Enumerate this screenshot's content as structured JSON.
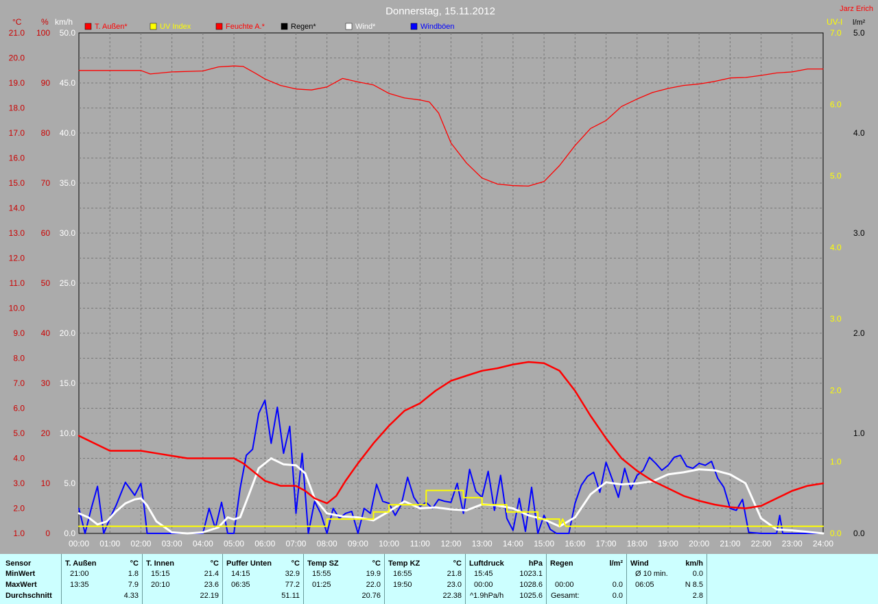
{
  "title": "Donnerstag, 15.11.2012",
  "author": "Jarz Erich",
  "units": {
    "temp": "°C",
    "hum": "%",
    "wind": "km/h",
    "uv": "UV-I",
    "rain": "l/m²"
  },
  "left_axes": {
    "temp_ticks": [
      "21.0",
      "20.0",
      "19.0",
      "18.0",
      "17.0",
      "16.0",
      "15.0",
      "14.0",
      "13.0",
      "12.0",
      "11.0",
      "10.0",
      "9.0",
      "8.0",
      "7.0",
      "6.0",
      "5.0",
      "4.0",
      "3.0",
      "2.0",
      "1.0"
    ],
    "hum_ticks": [
      "100",
      "90",
      "80",
      "70",
      "60",
      "50",
      "40",
      "30",
      "20",
      "10",
      "0"
    ],
    "wind_ticks": [
      "50.0",
      "45.0",
      "40.0",
      "35.0",
      "30.0",
      "25.0",
      "20.0",
      "15.0",
      "10.0",
      "5.0",
      "0.0"
    ]
  },
  "right_axes": {
    "uv_ticks": [
      "7.0",
      "6.0",
      "5.0",
      "4.0",
      "3.0",
      "2.0",
      "1.0",
      "0.0"
    ],
    "rain_ticks": [
      "5.0",
      "4.0",
      "3.0",
      "2.0",
      "1.0",
      "0.0"
    ]
  },
  "colors": {
    "temp": "#ff0000",
    "uv": "#ffff00",
    "hum": "#ff0000",
    "rain": "#000000",
    "wind": "#ffffff",
    "gust": "#0000ff",
    "left_axis": "#cc0000",
    "mid_axis": "#ffffff",
    "uv_axis": "#ffff00",
    "rain_axis": "#000000"
  },
  "chart_data": {
    "type": "line",
    "x_ticks": [
      "00:00",
      "01:00",
      "02:00",
      "03:00",
      "04:00",
      "05:00",
      "06:00",
      "07:00",
      "08:00",
      "09:00",
      "10:00",
      "11:00",
      "12:00",
      "13:00",
      "14:00",
      "15:00",
      "16:00",
      "17:00",
      "18:00",
      "19:00",
      "20:00",
      "21:00",
      "22:00",
      "23:00",
      "24:00"
    ],
    "x_range_hours": [
      0,
      24
    ],
    "grid": true,
    "legend_position": "top",
    "series": [
      {
        "name": "T. Außen*",
        "key": "temp",
        "axis": "temp",
        "ylim": [
          1,
          21
        ],
        "x": [
          0,
          0.5,
          1,
          1.5,
          2,
          2.5,
          3,
          3.5,
          4,
          4.5,
          5,
          5.3,
          5.6,
          6,
          6.5,
          7,
          7.3,
          7.6,
          8,
          8.3,
          8.6,
          9,
          9.5,
          10,
          10.5,
          11,
          11.5,
          12,
          12.5,
          13,
          13.5,
          14,
          14.5,
          15,
          15.5,
          16,
          16.5,
          17,
          17.5,
          18,
          18.5,
          19,
          19.5,
          20,
          20.5,
          21,
          21.5,
          22,
          22.5,
          23,
          23.5,
          24
        ],
        "y": [
          4.9,
          4.6,
          4.3,
          4.3,
          4.3,
          4.2,
          4.1,
          4.0,
          4.0,
          4.0,
          4.0,
          3.8,
          3.5,
          3.1,
          2.9,
          2.9,
          2.7,
          2.4,
          2.2,
          2.5,
          3.1,
          3.8,
          4.6,
          5.3,
          5.9,
          6.2,
          6.7,
          7.1,
          7.3,
          7.5,
          7.6,
          7.75,
          7.85,
          7.8,
          7.5,
          6.7,
          5.7,
          4.8,
          4.0,
          3.5,
          3.1,
          2.8,
          2.5,
          2.3,
          2.15,
          2.05,
          2.0,
          2.1,
          2.4,
          2.7,
          2.9,
          3.0
        ]
      },
      {
        "name": "UV Index",
        "key": "uv",
        "axis": "uv",
        "ylim": [
          0,
          7
        ],
        "x": [
          0,
          8,
          8,
          9.5,
          9.5,
          10,
          10,
          11.2,
          11.2,
          12.4,
          12.4,
          13,
          13,
          13.8,
          13.8,
          14.8,
          14.8,
          15.5,
          15.5,
          15.6,
          15.7,
          15.8,
          24
        ],
        "y": [
          0.1,
          0.1,
          0.2,
          0.2,
          0.3,
          0.3,
          0.4,
          0.4,
          0.6,
          0.6,
          0.5,
          0.5,
          0.4,
          0.4,
          0.3,
          0.3,
          0.2,
          0.2,
          0.1,
          0.2,
          0.1,
          0.1,
          0.1
        ]
      },
      {
        "name": "Feuchte A.*",
        "key": "hum",
        "axis": "hum",
        "ylim": [
          0,
          100
        ],
        "x": [
          0,
          1,
          2,
          2.3,
          3,
          4,
          4.5,
          5,
          5.3,
          5.7,
          6,
          6.5,
          7,
          7.5,
          8,
          8.5,
          9,
          9.5,
          10,
          10.5,
          11,
          11.3,
          11.6,
          12,
          12.5,
          13,
          13.5,
          14,
          14.5,
          15,
          15.5,
          16,
          16.5,
          17,
          17.5,
          18,
          18.5,
          19,
          19.5,
          20,
          20.5,
          21,
          21.5,
          22,
          22.5,
          23,
          23.5,
          24
        ],
        "y": [
          92.5,
          92.5,
          92.5,
          91.8,
          92.2,
          92.4,
          93.2,
          93.4,
          93.3,
          91.9,
          90.8,
          89.5,
          88.8,
          88.6,
          89.2,
          90.9,
          90.2,
          89.6,
          87.9,
          87.0,
          86.6,
          86.2,
          84.0,
          78.0,
          74.0,
          71.0,
          69.8,
          69.5,
          69.4,
          70.3,
          73.5,
          77.5,
          80.9,
          82.5,
          85.3,
          86.8,
          88.1,
          88.9,
          89.5,
          89.8,
          90.3,
          91.0,
          91.1,
          91.5,
          92.0,
          92.2,
          92.8,
          92.8
        ]
      },
      {
        "name": "Regen*",
        "key": "rain",
        "axis": "rain",
        "ylim": [
          0,
          5
        ],
        "x": [
          0,
          24
        ],
        "y": [
          0,
          0
        ]
      },
      {
        "name": "Wind*",
        "key": "wind",
        "axis": "wind",
        "ylim": [
          0,
          50
        ],
        "x": [
          0,
          0.3,
          0.6,
          0.9,
          1.2,
          1.5,
          1.8,
          2.0,
          2.2,
          2.5,
          3,
          3.5,
          4,
          4.5,
          4.8,
          5,
          5.2,
          5.5,
          5.8,
          6.2,
          6.6,
          7,
          7.3,
          7.6,
          8,
          8.5,
          9,
          9.5,
          10,
          10.5,
          11,
          11.5,
          12,
          12.5,
          13,
          13.5,
          14,
          14.5,
          15,
          15.5,
          16,
          16.5,
          17,
          17.5,
          18,
          18.5,
          19,
          19.5,
          20,
          20.5,
          21,
          21.5,
          22,
          22.5,
          23,
          24
        ],
        "y": [
          2.0,
          1.6,
          0.9,
          1.2,
          2.2,
          3.0,
          3.4,
          3.5,
          2.8,
          1.2,
          0.1,
          0.0,
          0.1,
          0.6,
          1.6,
          1.4,
          1.6,
          4.0,
          6.5,
          7.5,
          6.9,
          6.8,
          6.0,
          3.5,
          2.0,
          1.7,
          1.6,
          1.3,
          2.2,
          3.2,
          2.5,
          2.6,
          2.4,
          2.3,
          2.9,
          2.8,
          2.5,
          1.8,
          1.4,
          0.7,
          1.6,
          3.9,
          5.1,
          4.9,
          5.0,
          5.2,
          5.9,
          6.1,
          6.4,
          6.3,
          5.9,
          5.0,
          1.5,
          0.4,
          0.3,
          0.0
        ]
      },
      {
        "name": "Windböen",
        "key": "gust",
        "axis": "wind",
        "ylim": [
          0,
          50
        ],
        "x": [
          0,
          0.2,
          0.4,
          0.6,
          0.8,
          1.0,
          1.2,
          1.5,
          1.8,
          2.0,
          2.1,
          2.2,
          3.0,
          4.0,
          4.2,
          4.4,
          4.6,
          4.8,
          5.0,
          5.2,
          5.4,
          5.6,
          5.8,
          6.0,
          6.2,
          6.4,
          6.6,
          6.8,
          7.0,
          7.2,
          7.4,
          7.6,
          7.8,
          8.0,
          8.2,
          8.4,
          8.6,
          8.8,
          9.0,
          9.2,
          9.4,
          9.6,
          9.8,
          10.0,
          10.2,
          10.4,
          10.6,
          10.8,
          11.0,
          11.2,
          11.4,
          11.6,
          11.8,
          12.0,
          12.2,
          12.4,
          12.6,
          12.8,
          13.0,
          13.2,
          13.4,
          13.6,
          13.8,
          14.0,
          14.2,
          14.4,
          14.6,
          14.8,
          15.0,
          15.2,
          15.4,
          15.6,
          15.8,
          16.0,
          16.2,
          16.4,
          16.6,
          16.8,
          17.0,
          17.2,
          17.4,
          17.6,
          17.8,
          18.0,
          18.2,
          18.4,
          18.6,
          18.8,
          19.0,
          19.2,
          19.4,
          19.6,
          19.8,
          20.0,
          20.2,
          20.4,
          20.6,
          20.8,
          21.0,
          21.2,
          21.4,
          21.6,
          22.0,
          22.5,
          22.6,
          22.7,
          24
        ],
        "y": [
          2.5,
          0,
          2.5,
          4.7,
          0,
          1.5,
          2.8,
          5.1,
          3.8,
          5.0,
          2.8,
          0,
          0,
          0,
          2.5,
          0.5,
          3.1,
          0,
          0,
          4.5,
          7.8,
          8.4,
          12.0,
          13.3,
          9.0,
          12.6,
          8.0,
          10.7,
          2.0,
          8.0,
          0,
          3.2,
          2.0,
          0,
          2.5,
          1.5,
          2.0,
          2.2,
          0,
          2.5,
          2.0,
          4.9,
          3.2,
          3.0,
          1.8,
          2.9,
          5.6,
          3.6,
          2.7,
          3.1,
          2.5,
          3.4,
          3.2,
          3.1,
          5.0,
          2.0,
          6.4,
          4.2,
          3.6,
          6.2,
          2.3,
          5.8,
          1.5,
          0.3,
          3.5,
          0.2,
          4.6,
          0,
          1.8,
          0.4,
          0,
          0,
          0,
          3.0,
          4.8,
          5.7,
          6.1,
          4.1,
          7.1,
          5.4,
          3.6,
          6.5,
          4.4,
          5.8,
          6.3,
          7.6,
          7.0,
          6.3,
          6.8,
          7.6,
          7.8,
          6.7,
          6.5,
          7.0,
          6.8,
          7.2,
          5.5,
          4.6,
          2.5,
          2.3,
          3.4,
          0.1,
          0,
          0,
          1.8,
          0,
          0
        ]
      }
    ]
  },
  "stats": {
    "labels": {
      "head": "Sensor",
      "min": "MinWert",
      "max": "MaxWert",
      "avg": "Durchschnitt"
    },
    "groups": [
      {
        "name": "T. Außen",
        "unit": "°C",
        "min_time": "21:00",
        "min_val": "1.8",
        "max_time": "13:35",
        "max_val": "7.9",
        "avg_time": "",
        "avg_val": "4.33"
      },
      {
        "name": "T. Innen",
        "unit": "°C",
        "min_time": "15:15",
        "min_val": "21.4",
        "max_time": "20:10",
        "max_val": "23.6",
        "avg_time": "",
        "avg_val": "22.19"
      },
      {
        "name": "Puffer Unten",
        "unit": "°C",
        "min_time": "14:15",
        "min_val": "32.9",
        "max_time": "06:35",
        "max_val": "77.2",
        "avg_time": "",
        "avg_val": "51.11"
      },
      {
        "name": "Temp SZ",
        "unit": "°C",
        "min_time": "15:55",
        "min_val": "19.9",
        "max_time": "01:25",
        "max_val": "22.0",
        "avg_time": "",
        "avg_val": "20.76"
      },
      {
        "name": "Temp KZ",
        "unit": "°C",
        "min_time": "16:55",
        "min_val": "21.8",
        "max_time": "19:50",
        "max_val": "23.0",
        "avg_time": "",
        "avg_val": "22.38"
      },
      {
        "name": "Luftdruck",
        "unit": "hPa",
        "min_time": "15:45",
        "min_val": "1023.1",
        "max_time": "00:00",
        "max_val": "1028.6",
        "avg_time": "^1.9hPa/h",
        "avg_val": "1025.6"
      },
      {
        "name": "Regen",
        "unit": "l/m²",
        "min_time": "",
        "min_val": "",
        "max_time": "00:00",
        "max_val": "0.0",
        "avg_time": "Gesamt:",
        "avg_val": "0.0"
      },
      {
        "name": "Wind",
        "unit": "km/h",
        "min_time": "Ø 10 min.",
        "min_val": "0.0",
        "max_time": "06:05",
        "max_val": "N 8.5",
        "avg_time": "",
        "avg_val": "2.8"
      }
    ]
  }
}
